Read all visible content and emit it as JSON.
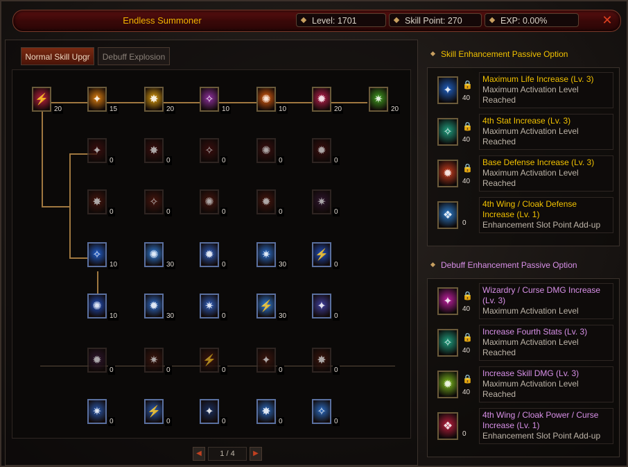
{
  "window": {
    "title": "Endless Summoner",
    "close_icon": "close-icon"
  },
  "stats": {
    "level": "Level: 1701",
    "skill_point": "Skill Point: 270",
    "exp": "EXP:  0.00%"
  },
  "tabs": [
    {
      "label": "Normal Skill Upgr",
      "active": true
    },
    {
      "label": "Debuff Explosion",
      "active": false
    }
  ],
  "skill_rows": [
    {
      "counts": [
        "20",
        "15",
        "20",
        "10",
        "10",
        "20",
        "20"
      ]
    },
    {
      "counts": [
        "0",
        "0",
        "0",
        "0",
        "0"
      ]
    },
    {
      "counts": [
        "0",
        "0",
        "0",
        "0",
        "0"
      ]
    },
    {
      "counts": [
        "10",
        "30",
        "0",
        "30",
        "0"
      ]
    },
    {
      "counts": [
        "10",
        "30",
        "0",
        "30",
        "0"
      ]
    },
    {
      "counts": [
        "0",
        "0",
        "0",
        "0",
        "0"
      ]
    },
    {
      "counts": [
        "0",
        "0",
        "0",
        "0",
        "0"
      ]
    }
  ],
  "pager": {
    "text": "1 / 4"
  },
  "skill_enhancement": {
    "title": "Skill Enhancement Passive Option",
    "options": [
      {
        "title": "Maximum Life Increase (Lv. 3)",
        "desc": "Maximum Activation Level Reached",
        "count": "40",
        "locked": true
      },
      {
        "title": "4th Stat Increase (Lv. 3)",
        "desc": "Maximum Activation Level Reached",
        "count": "40",
        "locked": true
      },
      {
        "title": "Base Defense Increase (Lv. 3)",
        "desc": "Maximum Activation Level Reached",
        "count": "40",
        "locked": true
      },
      {
        "title": "4th Wing / Cloak Defense Increase (Lv. 1)",
        "desc": "Enhancement Slot Point Add-up",
        "count": "0",
        "locked": false
      }
    ]
  },
  "debuff_enhancement": {
    "title": "Debuff Enhancement Passive Option",
    "options": [
      {
        "title": "Wizardry / Curse DMG Increase (Lv. 3)",
        "desc": "Maximum Activation Level",
        "count": "40",
        "locked": true
      },
      {
        "title": "Increase Fourth Stats (Lv. 3)",
        "desc": "Maximum Activation Level Reached",
        "count": "40",
        "locked": true
      },
      {
        "title": "Increase Skill DMG (Lv. 3)",
        "desc": "Maximum Activation Level Reached",
        "count": "40",
        "locked": true
      },
      {
        "title": "4th Wing / Cloak Power / Curse Increase (Lv. 1)",
        "desc": "Enhancement Slot Point Add-up",
        "count": "0",
        "locked": false
      }
    ]
  },
  "colors": {
    "accent_gold": "#f2c200",
    "accent_pink": "#d890e8",
    "title_bar": "#3a0808"
  }
}
